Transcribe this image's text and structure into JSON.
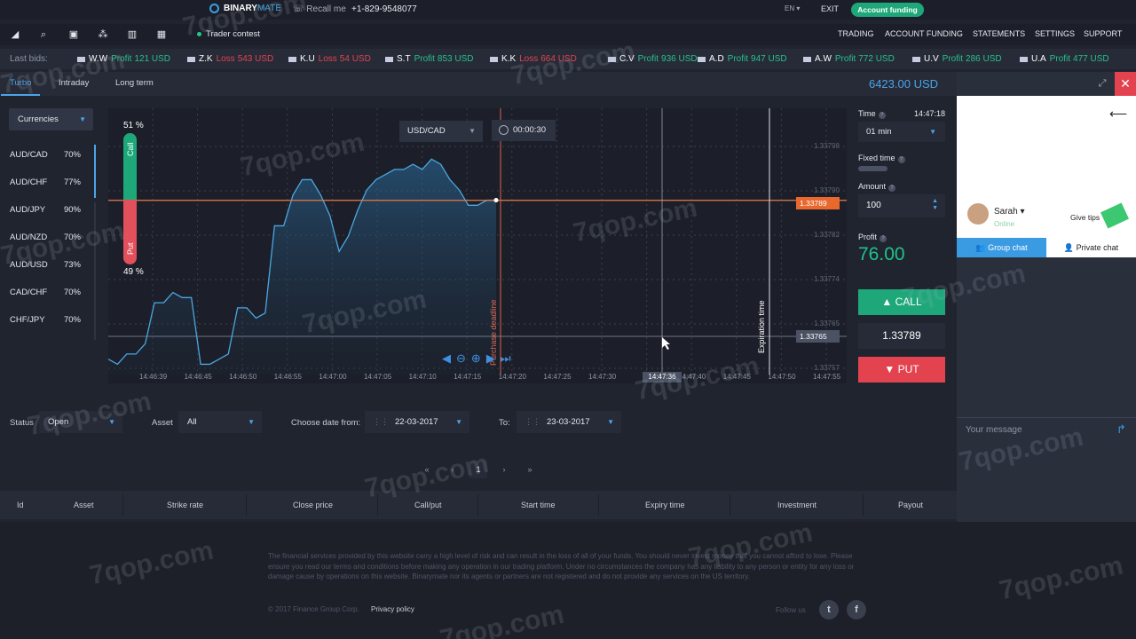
{
  "header": {
    "brand_part1": "BINARY",
    "brand_part2": "MATE",
    "recall": "Recall me",
    "phone": "+1-829-9548077",
    "language": "EN",
    "exit": "EXIT",
    "account_funding_button": "Account funding"
  },
  "navbar": {
    "contest": "Trader contest",
    "links": [
      "TRADING",
      "ACCOUNT FUNDING",
      "STATEMENTS",
      "SETTINGS",
      "SUPPORT"
    ]
  },
  "last_bids": {
    "label": "Last bids:",
    "items": [
      {
        "who": "W.W",
        "kind": "Profit",
        "amount": "121 USD"
      },
      {
        "who": "Z.K",
        "kind": "Loss",
        "amount": "543 USD"
      },
      {
        "who": "K.U",
        "kind": "Loss",
        "amount": "54 USD"
      },
      {
        "who": "S.T",
        "kind": "Profit",
        "amount": "853 USD"
      },
      {
        "who": "K.K",
        "kind": "Loss",
        "amount": "664 USD"
      },
      {
        "who": "C.V",
        "kind": "Profit",
        "amount": "936 USD"
      },
      {
        "who": "A.D",
        "kind": "Profit",
        "amount": "947 USD"
      },
      {
        "who": "A.W",
        "kind": "Profit",
        "amount": "772 USD"
      },
      {
        "who": "U.V",
        "kind": "Profit",
        "amount": "286 USD"
      },
      {
        "who": "U.A",
        "kind": "Profit",
        "amount": "477 USD"
      }
    ]
  },
  "tabs": [
    "Turbo",
    "Intraday",
    "Long term"
  ],
  "balance": "6423.00 USD",
  "asset_list": {
    "filter": "Currencies",
    "items": [
      {
        "pair": "AUD/CAD",
        "pct": "70%"
      },
      {
        "pair": "AUD/CHF",
        "pct": "77%"
      },
      {
        "pair": "AUD/JPY",
        "pct": "90%"
      },
      {
        "pair": "AUD/NZD",
        "pct": "70%"
      },
      {
        "pair": "AUD/USD",
        "pct": "73%"
      },
      {
        "pair": "CAD/CHF",
        "pct": "70%"
      },
      {
        "pair": "CHF/JPY",
        "pct": "70%"
      }
    ]
  },
  "chart": {
    "pair": "USD/CAD",
    "countdown": "00:00:30",
    "call_label": "Call",
    "put_label": "Put",
    "call_pct": "51 %",
    "put_pct": "49 %",
    "call_fraction": 0.51,
    "y_ticks": [
      "1.33798",
      "1.33790",
      "1.33782",
      "1.33774",
      "1.33765",
      "1.33757"
    ],
    "current_price_tag": "1.33789",
    "strike_tag": "1.33765",
    "x_ticks": [
      "14:46:39",
      "14:46:45",
      "14:46:50",
      "14:46:55",
      "14:47:00",
      "14:47:05",
      "14:47:10",
      "14:47:15",
      "14:47:20",
      "14:47:25",
      "14:47:30",
      "14:47:36",
      "14:47:40",
      "14:47:45",
      "14:47:50",
      "14:47:55"
    ],
    "current_time": "14:47:36",
    "purchase_deadline": "Purchase deadline",
    "expiration_time": "Expiration time",
    "series": [
      1.33758,
      1.33757,
      1.33759,
      1.33759,
      1.33761,
      1.33769,
      1.33769,
      1.33771,
      1.3377,
      1.3377,
      1.33757,
      1.33757,
      1.33758,
      1.33759,
      1.33768,
      1.33768,
      1.33766,
      1.33767,
      1.33784,
      1.33784,
      1.3379,
      1.33793,
      1.33793,
      1.3379,
      1.33786,
      1.33779,
      1.33782,
      1.33787,
      1.33791,
      1.33793,
      1.33794,
      1.33795,
      1.33795,
      1.33796,
      1.33795,
      1.33797,
      1.33796,
      1.33793,
      1.33791,
      1.33788,
      1.33788,
      1.33789,
      1.33789
    ]
  },
  "trade_panel": {
    "time_label": "Time",
    "clock": "14:47:18",
    "time_value": "01 min",
    "fixed_time_label": "Fixed time",
    "amount_label": "Amount",
    "amount_value": "100",
    "profit_label": "Profit",
    "profit_value": "76.00",
    "call_button": "CALL",
    "current_price": "1.33789",
    "put_button": "PUT"
  },
  "chat": {
    "agent_name": "Sarah",
    "status": "Online",
    "give_tips": "Give tips",
    "group_tab": "Group chat",
    "private_tab": "Private chat",
    "message_placeholder": "Your message"
  },
  "filters": {
    "status_label": "Status",
    "status_value": "Open",
    "asset_label": "Asset",
    "asset_value": "All",
    "date_from_label": "Choose date from:",
    "date_from": "22-03-2017",
    "to_label": "To:",
    "date_to": "23-03-2017"
  },
  "pagination": {
    "first": "«",
    "prev": "‹",
    "current": "1",
    "next": "›",
    "last": "»"
  },
  "table_headers": [
    "Id",
    "Asset",
    "Strike rate",
    "Close price",
    "Call/put",
    "Start time",
    "Expiry time",
    "Investment",
    "Payout"
  ],
  "footer": {
    "disclaimer": "The financial services provided by this website carry a high level of risk and can result in the loss of all of your funds. You should never invest money that you cannot afford to lose. Please ensure you read our terms and conditions before making any operation in our trading platform. Under no circumstances the company has any liability to any person or entity for any loss or damage cause by operations on this website. Binarymate nor its agents or partners are not registered and do not provide any services on the US territory.",
    "copyright": "© 2017 Finance Group Corp.",
    "privacy": "Privacy policy",
    "follow": "Follow us"
  },
  "watermark": "7qop.com",
  "colors": {
    "accent": "#4ca3ea",
    "call": "#1ea87a",
    "put": "#e2434f",
    "profit": "#27c08a",
    "loss": "#e2434f"
  }
}
